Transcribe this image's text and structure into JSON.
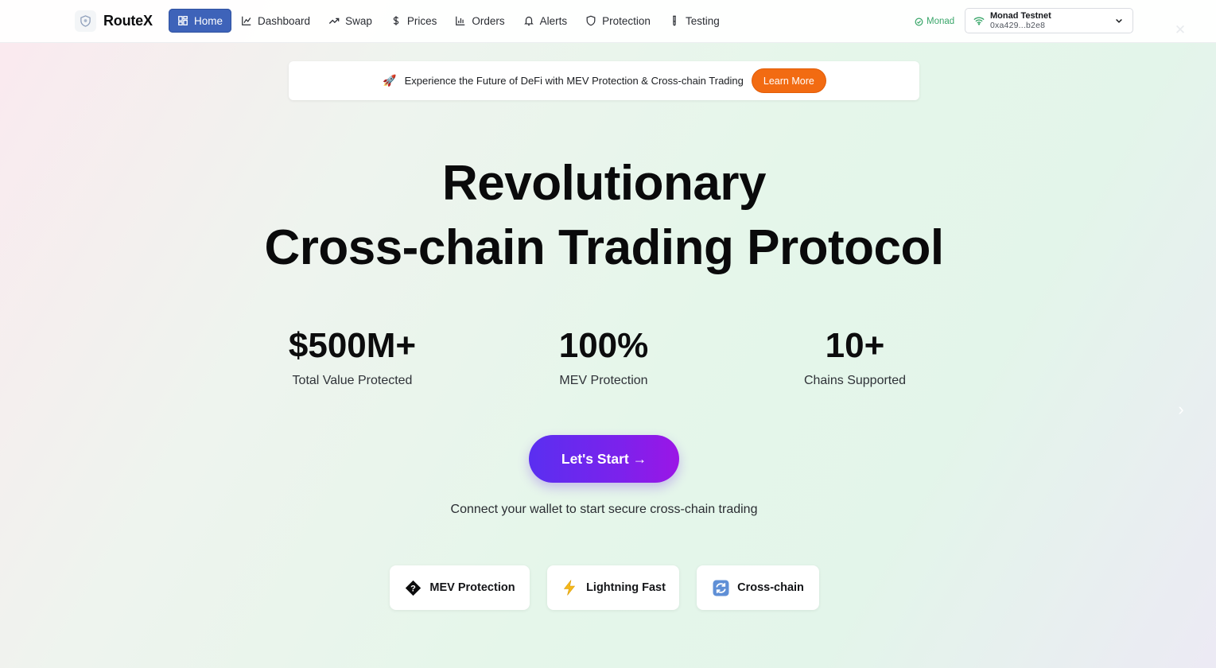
{
  "header": {
    "brand": "RouteX",
    "nav": [
      {
        "label": "Home",
        "icon": "grid-icon",
        "active": true
      },
      {
        "label": "Dashboard",
        "icon": "chart-line-icon"
      },
      {
        "label": "Swap",
        "icon": "trending-up-icon"
      },
      {
        "label": "Prices",
        "icon": "dollar-icon"
      },
      {
        "label": "Orders",
        "icon": "bar-chart-icon"
      },
      {
        "label": "Alerts",
        "icon": "bell-icon"
      },
      {
        "label": "Protection",
        "icon": "shield-icon"
      },
      {
        "label": "Testing",
        "icon": "test-tube-icon"
      }
    ],
    "network_status": "Monad",
    "wallet": {
      "network": "Monad Testnet",
      "address": "0xa429...b2e8"
    }
  },
  "announcement": {
    "icon": "🚀",
    "text": "Experience the Future of DeFi with MEV Protection & Cross-chain Trading",
    "button": "Learn More"
  },
  "hero": {
    "title_line1": "Revolutionary",
    "title_line2": "Cross-chain Trading Protocol"
  },
  "stats": [
    {
      "value": "$500M+",
      "label": "Total Value Protected"
    },
    {
      "value": "100%",
      "label": "MEV Protection"
    },
    {
      "value": "10+",
      "label": "Chains Supported"
    }
  ],
  "cta": {
    "label": "Let's Start →",
    "subtext": "Connect your wallet to start secure cross-chain trading"
  },
  "features": [
    {
      "label": "MEV Protection",
      "icon": "diamond-question-icon"
    },
    {
      "label": "Lightning Fast",
      "icon": "lightning-icon"
    },
    {
      "label": "Cross-chain",
      "icon": "refresh-icon"
    }
  ],
  "colors": {
    "nav_active": "#3e63b9",
    "learn_more": "#f26b12",
    "cta_start": "#5a2ff0",
    "cta_end": "#9b16e6",
    "status_green": "#3aa66a"
  }
}
